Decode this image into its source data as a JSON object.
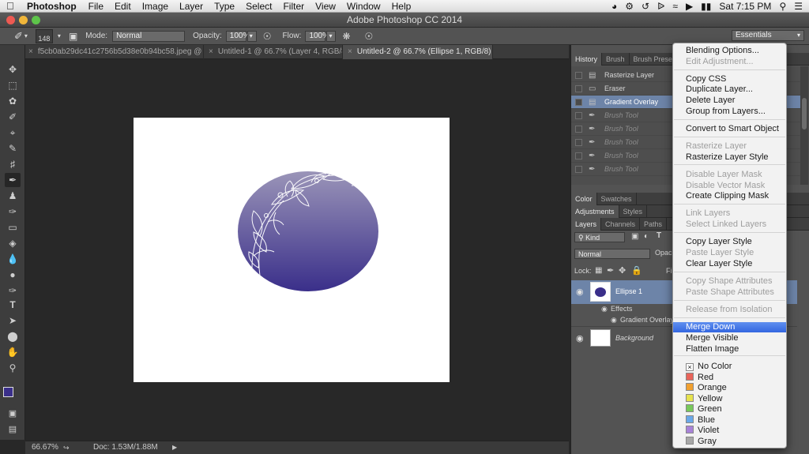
{
  "menubar": {
    "app_name": "Photoshop",
    "menus": [
      "File",
      "Edit",
      "Image",
      "Layer",
      "Type",
      "Select",
      "Filter",
      "View",
      "Window",
      "Help"
    ],
    "clock": "Sat 7:15 PM"
  },
  "window": {
    "title": "Adobe Photoshop CC 2014"
  },
  "options_bar": {
    "brush_size": "148",
    "mode_label": "Mode:",
    "mode_value": "Normal",
    "opacity_label": "Opacity:",
    "opacity_value": "100%",
    "flow_label": "Flow:",
    "flow_value": "100%",
    "workspace": "Essentials"
  },
  "doc_tabs": [
    {
      "label": "f5cb0ab29dc41c2756b5d38e0b94bc58.jpeg @ 66.7% (RGB/8...",
      "active": false
    },
    {
      "label": "Untitled-1 @ 66.7% (Layer 4, RGB/8...",
      "active": false
    },
    {
      "label": "Untitled-2 @ 66.7% (Ellipse 1, RGB/8) *",
      "active": true
    }
  ],
  "status": {
    "zoom": "66.67%",
    "doc": "Doc: 1.53M/1.88M"
  },
  "history_tabs": [
    "History",
    "Brush",
    "Brush Presets"
  ],
  "history": [
    {
      "label": "Rasterize Layer",
      "dim": false,
      "sel": false
    },
    {
      "label": "Eraser",
      "dim": false,
      "sel": false
    },
    {
      "label": "Gradient Overlay",
      "dim": false,
      "sel": true
    },
    {
      "label": "Brush Tool",
      "dim": true,
      "sel": false
    },
    {
      "label": "Brush Tool",
      "dim": true,
      "sel": false
    },
    {
      "label": "Brush Tool",
      "dim": true,
      "sel": false
    },
    {
      "label": "Brush Tool",
      "dim": true,
      "sel": false
    },
    {
      "label": "Brush Tool",
      "dim": true,
      "sel": false
    }
  ],
  "color_tabs": [
    "Color",
    "Swatches"
  ],
  "adjust_tabs": [
    "Adjustments",
    "Styles"
  ],
  "layers_tabs": [
    "Layers",
    "Channels",
    "Paths"
  ],
  "layers_panel": {
    "kind": "Kind",
    "blend": "Normal",
    "opacity_label": "Opacit",
    "lock_label": "Lock:",
    "fill_label": "Fi",
    "layers": {
      "ellipse": "Ellipse 1",
      "effects": "Effects",
      "gradient": "Gradient Overlay",
      "background": "Background"
    }
  },
  "context_menu": {
    "items": [
      {
        "label": "Blending Options...",
        "disabled": false
      },
      {
        "label": "Edit Adjustment...",
        "disabled": true
      },
      {
        "label": "Copy CSS",
        "disabled": false
      },
      {
        "label": "Duplicate Layer...",
        "disabled": false
      },
      {
        "label": "Delete Layer",
        "disabled": false
      },
      {
        "label": "Group from Layers...",
        "disabled": false
      },
      {
        "label": "Convert to Smart Object",
        "disabled": false
      },
      {
        "label": "Rasterize Layer",
        "disabled": true
      },
      {
        "label": "Rasterize Layer Style",
        "disabled": false
      },
      {
        "label": "Disable Layer Mask",
        "disabled": true
      },
      {
        "label": "Disable Vector Mask",
        "disabled": true
      },
      {
        "label": "Create Clipping Mask",
        "disabled": false
      },
      {
        "label": "Link Layers",
        "disabled": true
      },
      {
        "label": "Select Linked Layers",
        "disabled": true
      },
      {
        "label": "Copy Layer Style",
        "disabled": false
      },
      {
        "label": "Paste Layer Style",
        "disabled": true
      },
      {
        "label": "Clear Layer Style",
        "disabled": false
      },
      {
        "label": "Copy Shape Attributes",
        "disabled": true
      },
      {
        "label": "Paste Shape Attributes",
        "disabled": true
      },
      {
        "label": "Release from Isolation",
        "disabled": true
      },
      {
        "label": "Merge Down",
        "disabled": false,
        "highlighted": true
      },
      {
        "label": "Merge Visible",
        "disabled": false
      },
      {
        "label": "Flatten Image",
        "disabled": false
      }
    ],
    "colors": [
      {
        "label": "No Color",
        "hex": "#ffffff"
      },
      {
        "label": "Red",
        "hex": "#e8645a"
      },
      {
        "label": "Orange",
        "hex": "#f0a030"
      },
      {
        "label": "Yellow",
        "hex": "#e6e24e"
      },
      {
        "label": "Green",
        "hex": "#78c85a"
      },
      {
        "label": "Blue",
        "hex": "#6aa8e8"
      },
      {
        "label": "Violet",
        "hex": "#a882d8"
      },
      {
        "label": "Gray",
        "hex": "#a8a8a8"
      }
    ]
  },
  "colors": {
    "foreground": "#3a2f8a",
    "gradient_top": "#9a94b8",
    "gradient_bottom": "#3a2f8a"
  }
}
